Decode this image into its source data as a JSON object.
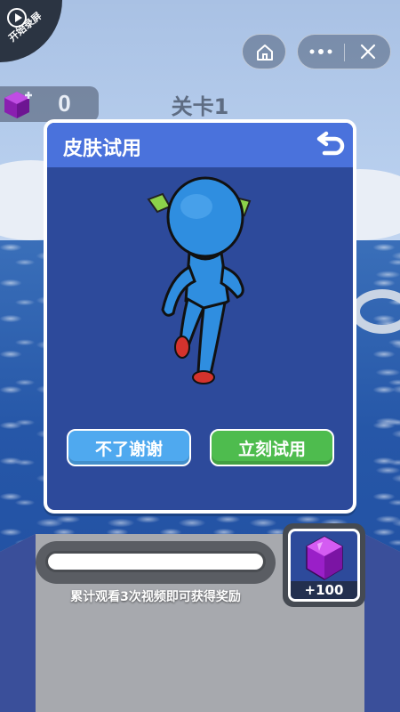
{
  "top_bar": {
    "record_label": "开始录屏"
  },
  "hud": {
    "gem_count": "0",
    "level_label": "关卡1"
  },
  "modal": {
    "title": "皮肤试用",
    "decline_label": "不了谢谢",
    "accept_label": "立刻试用"
  },
  "reward": {
    "progress": 0,
    "hint": "累计观看3次视频即可获得奖励",
    "amount_label": "+100"
  },
  "colors": {
    "modal_bg": "#2d4a9b",
    "modal_header": "#4a72dc",
    "decline_button": "#4fa9ef",
    "accept_button": "#4ebc4e",
    "gem": "#b62ad8"
  },
  "icons": {
    "record": "play-circle-icon",
    "home": "home-icon",
    "more": "more-dots-icon",
    "close": "close-icon",
    "back": "back-arrow-icon",
    "gem": "gem-icon"
  }
}
